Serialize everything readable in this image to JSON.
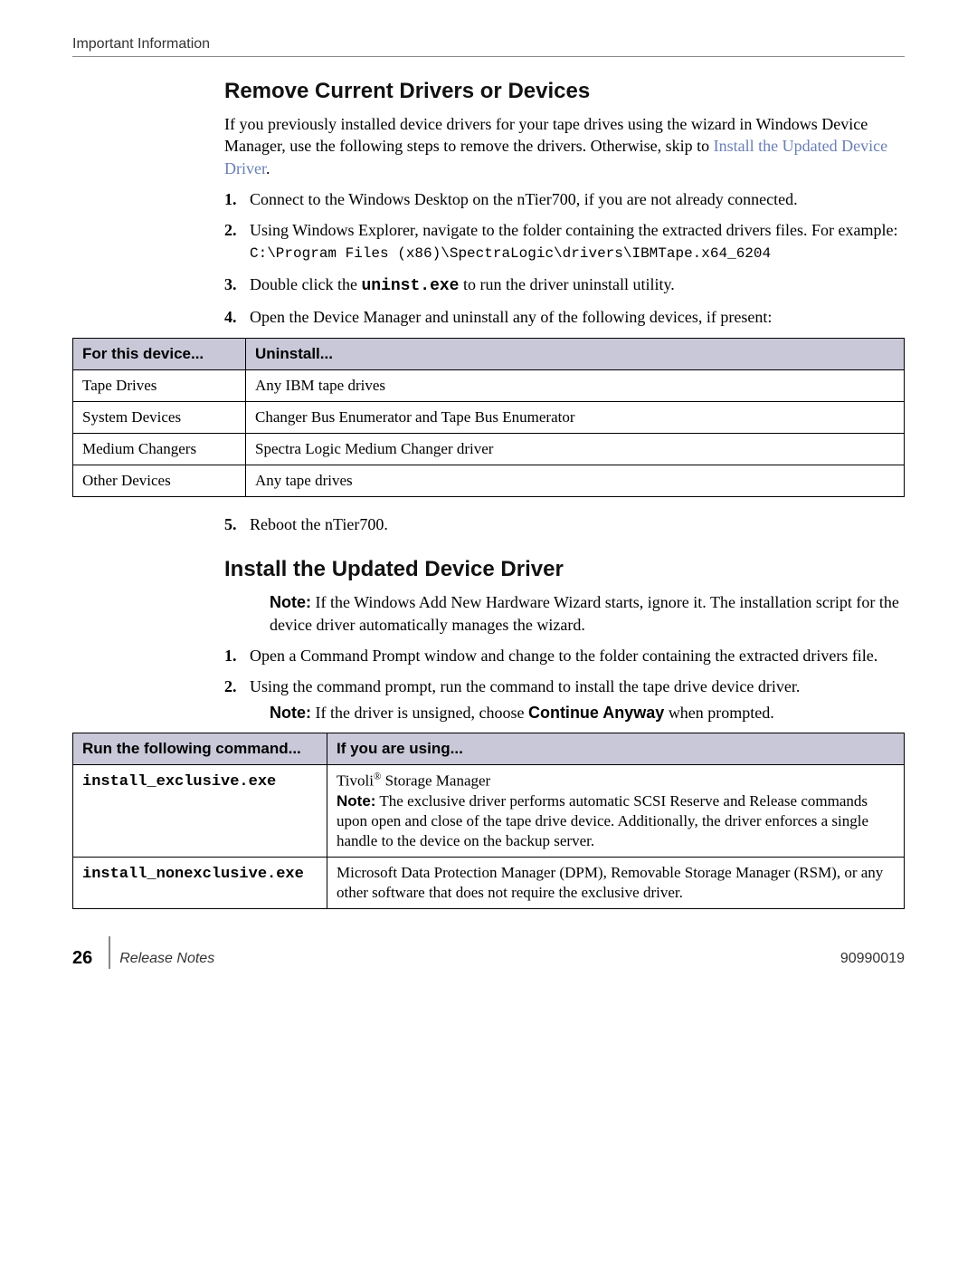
{
  "header": {
    "running": "Important Information"
  },
  "section1": {
    "title": "Remove Current Drivers or Devices",
    "intro_pre": "If you previously installed device drivers for your tape drives using the wizard in Windows Device Manager, use the following steps to remove the drivers. Otherwise, skip to ",
    "intro_link": "Install the Updated Device Driver",
    "intro_post": ".",
    "steps": {
      "s1": "Connect to the Windows Desktop on the nTier700, if you are not already connected.",
      "s2": "Using Windows Explorer, navigate to the folder containing the extracted drivers files. For example:",
      "s2_code": "C:\\Program Files (x86)\\SpectraLogic\\drivers\\IBMTape.x64_6204",
      "s3_pre": "Double click the ",
      "s3_code": "uninst.exe",
      "s3_post": " to run the driver uninstall utility.",
      "s4": "Open the Device Manager and uninstall any of the following devices, if present:",
      "s5": "Reboot the nTier700."
    }
  },
  "table1": {
    "h1": "For this device...",
    "h2": "Uninstall...",
    "rows": [
      {
        "c1": "Tape Drives",
        "c2": "Any IBM tape drives"
      },
      {
        "c1": "System Devices",
        "c2": "Changer Bus Enumerator and Tape Bus Enumerator"
      },
      {
        "c1": "Medium Changers",
        "c2": "Spectra Logic Medium Changer driver"
      },
      {
        "c1": "Other Devices",
        "c2": "Any tape drives"
      }
    ]
  },
  "section2": {
    "title": "Install the Updated Device Driver",
    "note1_label": "Note:",
    "note1": "If the Windows Add New Hardware Wizard starts, ignore it. The installation script for the device driver automatically manages the wizard.",
    "steps": {
      "s1": "Open a Command Prompt window and change to the folder containing the extracted drivers file.",
      "s2": "Using the command prompt, run the command to install the tape drive device driver.",
      "s2_note_label": "Note:",
      "s2_note_pre": "If the driver is unsigned, choose ",
      "s2_note_bold": "Continue Anyway",
      "s2_note_post": " when prompted."
    }
  },
  "table2": {
    "h1": "Run the following command...",
    "h2": "If you are using...",
    "rows": [
      {
        "c1": "install_exclusive.exe",
        "c2_line1_pre": "Tivoli",
        "c2_line1_post": " Storage Manager",
        "c2_note_label": "Note:",
        "c2_note": " The exclusive driver performs automatic SCSI Reserve and Release commands upon open and close of the tape drive device. Additionally, the driver enforces a single handle to the device on the backup server."
      },
      {
        "c1": "install_nonexclusive.exe",
        "c2": "Microsoft Data Protection Manager (DPM), Removable Storage Manager (RSM), or any other software that does not require the exclusive driver."
      }
    ]
  },
  "footer": {
    "page": "26",
    "title": "Release Notes",
    "docid": "90990019"
  }
}
